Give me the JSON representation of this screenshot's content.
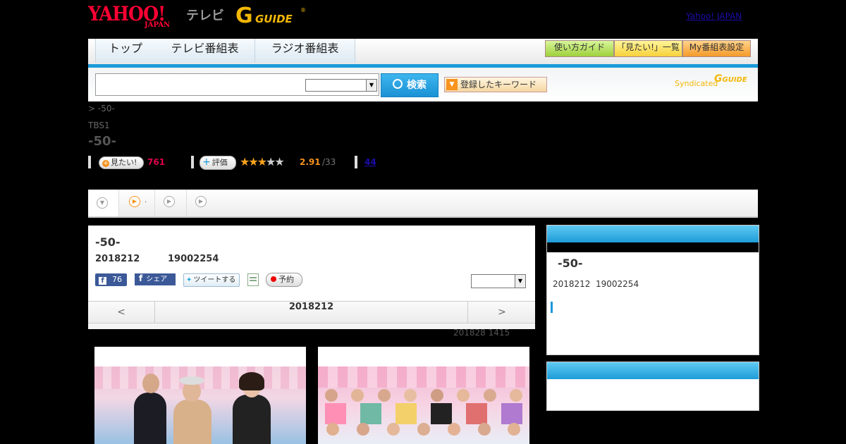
{
  "header": {
    "yahoo_logo": "YAHOO!",
    "yahoo_japan": "JAPAN",
    "tv": "テレビ",
    "gguide_g": "G",
    "gguide_text": "GUIDE",
    "gguide_reg": "®",
    "yahoo_link": "Yahoo! JAPAN"
  },
  "nav": {
    "tabs": [
      "トップ",
      "テレビ番組表",
      "ラジオ番組表"
    ],
    "buttons": [
      "使い方ガイド",
      "「見たい!」一覧",
      "My番組表設定"
    ]
  },
  "search": {
    "button_label": "検索",
    "keyword_label": "登録したキーワード",
    "syndicated": "Syndicated"
  },
  "program": {
    "breadcrumb": "> -50-",
    "channel": "TBS1",
    "title": "-50-",
    "want_label": "見たい!",
    "want_count": "761",
    "rate_label": "評価",
    "rating_value": "2.91",
    "rating_count": "/33",
    "rating_stars": 2.91,
    "link_count": "44"
  },
  "main": {
    "title": "-50-",
    "date": "2018212",
    "time": "19002254",
    "fb_count": "76",
    "share_label": "シェア",
    "tweet_label": "ツイートする",
    "reserve_label": "予約",
    "date_nav_prev": "<",
    "date_nav_date": "2018212",
    "date_nav_next": ">",
    "updated": "201828  1415"
  },
  "sidebar": {
    "title": "-50-",
    "date": "2018212",
    "time": "19002254"
  },
  "colors": {
    "accent_blue": "#1a9ad9",
    "want_pink": "#e0004c",
    "rating_orange": "#f7931e",
    "gguide_yellow": "#f2b705"
  }
}
